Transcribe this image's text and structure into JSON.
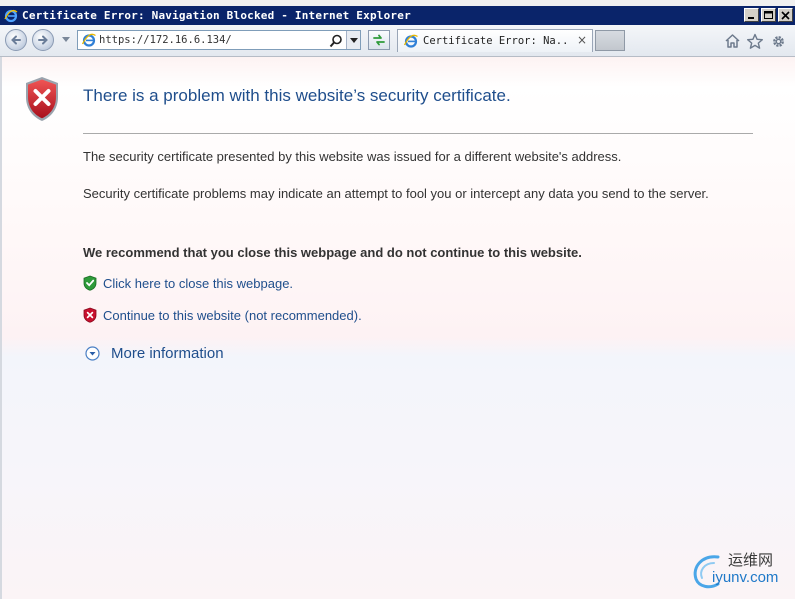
{
  "window": {
    "title": "Certificate Error: Navigation Blocked - Internet Explorer"
  },
  "navbar": {
    "address": "https://172.16.6.134/",
    "tab_label": "Certificate Error: Na...",
    "tab_close": "×"
  },
  "page": {
    "heading": "There is a problem with this website’s security certificate.",
    "para1": "The security certificate presented by this website was issued for a different website's address.",
    "para2": "Security certificate problems may indicate an attempt to fool you or intercept any data you send to the server.",
    "recommendation": "We recommend that you close this webpage and do not continue to this website.",
    "close_link": "Click here to close this webpage.",
    "continue_link": "Continue to this website (not recommended).",
    "more_info": "More information"
  },
  "watermark": {
    "cn": "运维网",
    "en": "iyunv.com"
  },
  "colors": {
    "title_bar": "#0a246a",
    "link": "#1f4e8c",
    "heading": "#1f4e8c",
    "error_red": "#c8102e",
    "safe_green": "#2e9b3a"
  },
  "icons": {
    "back": "back-arrow-icon",
    "forward": "forward-arrow-icon",
    "refresh": "refresh-icon",
    "home": "home-icon",
    "favorites": "star-icon",
    "tools": "gear-icon",
    "error_shield": "error-shield-icon",
    "safe_shield": "green-shield-icon",
    "more_info_chevron": "chevron-down-circle-icon"
  }
}
